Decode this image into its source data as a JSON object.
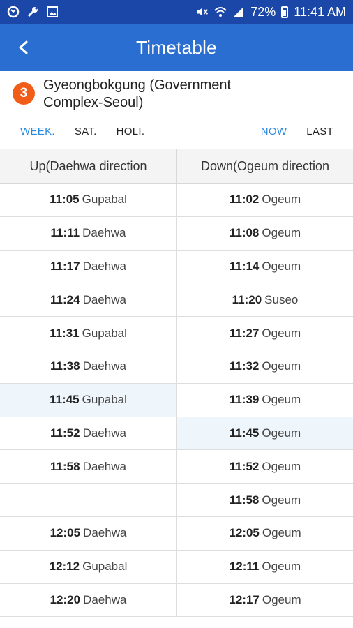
{
  "status_bar": {
    "battery": "72%",
    "time": "11:41 AM",
    "left_icons": [
      "sync-icon",
      "wrench-icon",
      "image-icon"
    ],
    "right_icons": [
      "mute-icon",
      "wifi-icon",
      "signal-icon",
      "battery-icon"
    ]
  },
  "app_bar": {
    "title": "Timetable"
  },
  "station": {
    "line": "3",
    "name_line1": "Gyeongbokgung (Government",
    "name_line2": "Complex-Seoul)",
    "line_color": "#f25c19"
  },
  "tabs": {
    "week": "WEEK.",
    "sat": "SAT.",
    "holi": "HOLI.",
    "now": "NOW",
    "last": "LAST"
  },
  "table": {
    "headers": [
      "Up(Daehwa direction",
      "Down(Ogeum direction"
    ],
    "rows": [
      {
        "up_time": "11:05",
        "up_dest": "Gupabal",
        "down_time": "11:02",
        "down_dest": "Ogeum"
      },
      {
        "up_time": "11:11",
        "up_dest": "Daehwa",
        "down_time": "11:08",
        "down_dest": "Ogeum"
      },
      {
        "up_time": "11:17",
        "up_dest": "Daehwa",
        "down_time": "11:14",
        "down_dest": "Ogeum"
      },
      {
        "up_time": "11:24",
        "up_dest": "Daehwa",
        "down_time": "11:20",
        "down_dest": "Suseo"
      },
      {
        "up_time": "11:31",
        "up_dest": "Gupabal",
        "down_time": "11:27",
        "down_dest": "Ogeum"
      },
      {
        "up_time": "11:38",
        "up_dest": "Daehwa",
        "down_time": "11:32",
        "down_dest": "Ogeum"
      },
      {
        "up_time": "11:45",
        "up_dest": "Gupabal",
        "down_time": "11:39",
        "down_dest": "Ogeum"
      },
      {
        "up_time": "11:52",
        "up_dest": "Daehwa",
        "down_time": "11:45",
        "down_dest": "Ogeum"
      },
      {
        "up_time": "11:58",
        "up_dest": "Daehwa",
        "down_time": "11:52",
        "down_dest": "Ogeum"
      },
      {
        "up_time": "",
        "up_dest": "",
        "down_time": "11:58",
        "down_dest": "Ogeum"
      },
      {
        "up_time": "12:05",
        "up_dest": "Daehwa",
        "down_time": "12:05",
        "down_dest": "Ogeum"
      },
      {
        "up_time": "12:12",
        "up_dest": "Gupabal",
        "down_time": "12:11",
        "down_dest": "Ogeum"
      },
      {
        "up_time": "12:20",
        "up_dest": "Daehwa",
        "down_time": "12:17",
        "down_dest": "Ogeum"
      }
    ]
  }
}
